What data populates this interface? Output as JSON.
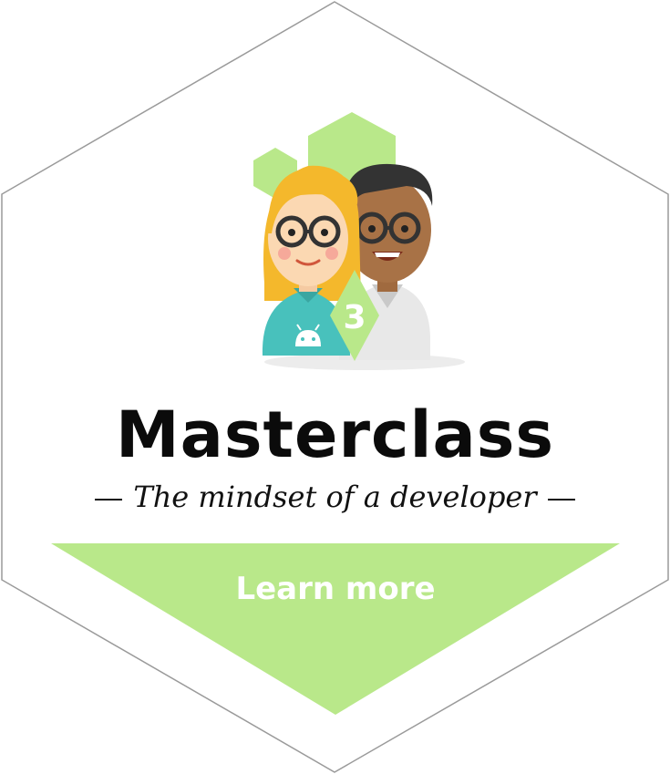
{
  "badge": {
    "title": "Masterclass",
    "subtitle": "The mindset of a developer",
    "level_number": "3",
    "cta_label": "Learn more"
  },
  "colors": {
    "accent_green": "#b9e88a",
    "outline": "#9a9a9a",
    "title_text": "#0b0b0b"
  },
  "icons": [
    "android-icon",
    "developer-avatars-illustration",
    "level-diamond-icon"
  ]
}
